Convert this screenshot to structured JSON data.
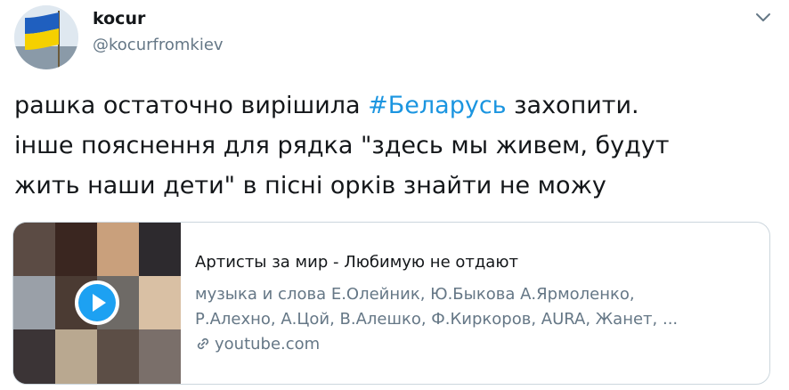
{
  "author": {
    "name": "kocur",
    "handle": "@kocurfromkiev"
  },
  "tweet": {
    "line1_pre": "рашка остаточно вирішила ",
    "line1_hashtag": "#Беларусь",
    "line1_post": " захопити.",
    "line2": "інше пояснення для рядка \"здесь мы живем, будут",
    "line3": "жить наши дети\" в пісні орків знайти не можу"
  },
  "card": {
    "title": "Артисты за мир - Любимую не отдают",
    "desc_line1": "музыка и слова Е.Олейник, Ю.Быкова А.Ярмоленко,",
    "desc_line2": "Р.Алехно, А.Цой, В.Алешко, Ф.Киркоров, AURA, Жанет, ...",
    "link": "youtube.com"
  },
  "colors": {
    "hashtag": "#1b95e0",
    "secondary_text": "#657786",
    "play_button": "#1da1f2",
    "flag_blue": "#1f5fbf",
    "flag_yellow": "#f5d000"
  },
  "icons": [
    "ukraine-flag-avatar",
    "chevron-down-icon",
    "play-icon",
    "link-icon"
  ]
}
